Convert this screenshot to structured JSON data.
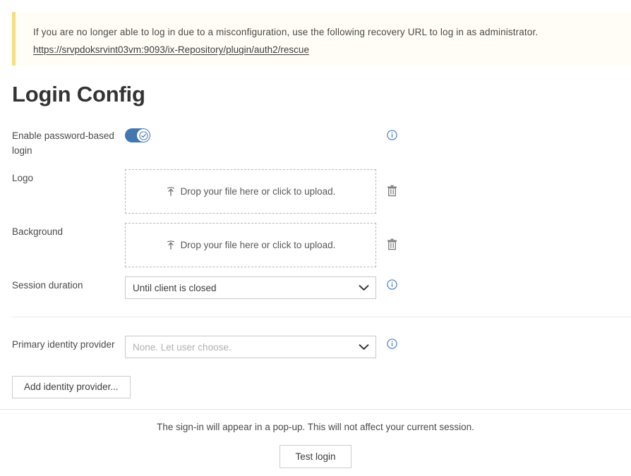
{
  "banner": {
    "message": "If you are no longer able to log in due to a misconfiguration, use the following recovery URL to log in as administrator.",
    "link": "https://srvpdoksrvint03vm:9093/ix-Repository/plugin/auth2/rescue",
    "accent_color": "#f7dd80",
    "background_color": "#fffdf5"
  },
  "page": {
    "title": "Login Config"
  },
  "form": {
    "password_login": {
      "label": "Enable password-based login",
      "toggle_state": "on",
      "toggle_color": "#4477b0",
      "info_icon": "info-icon"
    },
    "logo": {
      "label": "Logo",
      "dropzone_text": "Drop your file here or click to upload.",
      "upload_icon": "upload-icon",
      "delete_icon": "trash-icon"
    },
    "background": {
      "label": "Background",
      "dropzone_text": "Drop your file here or click to upload.",
      "upload_icon": "upload-icon",
      "delete_icon": "trash-icon"
    },
    "session_duration": {
      "label": "Session duration",
      "value": "Until client is closed",
      "chevron_icon": "chevron-down-icon",
      "info_icon": "info-icon"
    },
    "primary_identity_provider": {
      "label": "Primary identity provider",
      "placeholder": "None. Let user choose.",
      "value": "",
      "chevron_icon": "chevron-down-icon",
      "info_icon": "info-icon"
    },
    "add_identity_provider_label": "Add identity provider..."
  },
  "footer": {
    "note": "The sign-in will appear in a pop-up. This will not affect your current session.",
    "test_login_label": "Test login"
  }
}
